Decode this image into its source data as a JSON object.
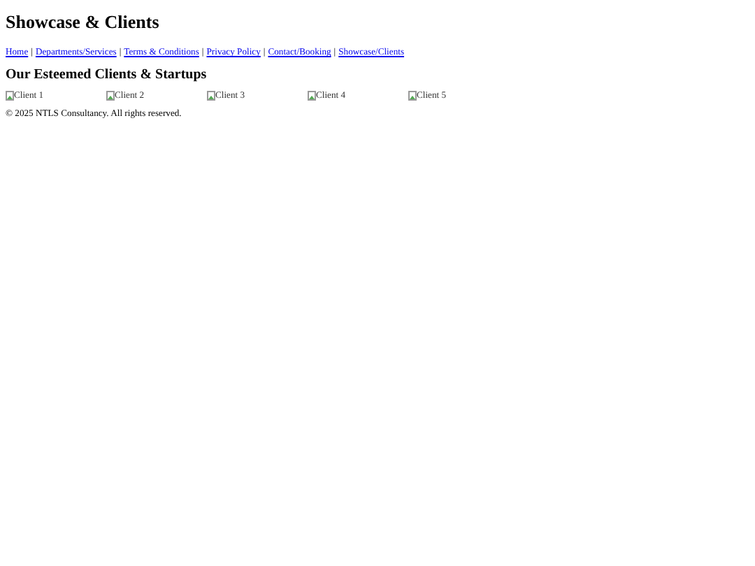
{
  "page_title": "Showcase & Clients",
  "nav": [
    {
      "kind": "link",
      "text": "Home"
    },
    {
      "kind": "separator",
      "text": "|"
    },
    {
      "kind": "link",
      "text": "Departments/Services"
    },
    {
      "kind": "separator",
      "text": "|"
    },
    {
      "kind": "link",
      "text": "Terms & Conditions"
    },
    {
      "kind": "separator",
      "text": "|"
    },
    {
      "kind": "link",
      "text": "Privacy Policy"
    },
    {
      "kind": "separator",
      "text": "|"
    },
    {
      "kind": "link",
      "text": "Contact/Booking"
    },
    {
      "kind": "separator",
      "text": "|"
    },
    {
      "kind": "link",
      "text": "Showcase/Clients"
    }
  ],
  "section_heading": "Our Esteemed Clients & Startups",
  "clients": [
    "Client 1",
    "Client 2",
    "Client 3",
    "Client 4",
    "Client 5"
  ],
  "footer": "© 2025 NTLS Consultancy. All rights reserved."
}
